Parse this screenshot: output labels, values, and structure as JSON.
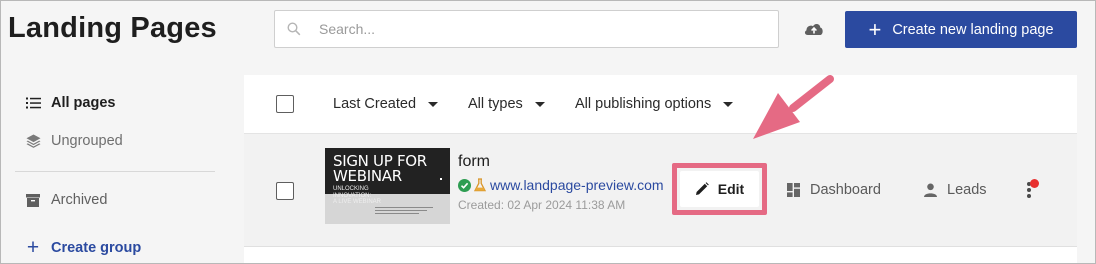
{
  "header": {
    "title": "Landing Pages",
    "search_placeholder": "Search...",
    "upload_icon": "cloud-upload-icon",
    "create_label": "Create new landing page",
    "accent": "#2b4aa0"
  },
  "sidebar": {
    "items": [
      {
        "label": "All pages",
        "icon": "list-icon",
        "active": true
      },
      {
        "label": "Ungrouped",
        "icon": "layers-icon"
      },
      {
        "label": "Archived",
        "icon": "archive-icon"
      },
      {
        "label": "Create group",
        "icon": "plus-icon"
      }
    ]
  },
  "filters": {
    "sort": "Last Created",
    "types": "All types",
    "publishing": "All publishing options"
  },
  "row": {
    "thumbnail": {
      "headline_1": "SIGN UP FOR",
      "headline_2": "WEBINAR",
      "sub_1": "UNLOCKING",
      "sub_2": "INNOVATION:",
      "sub_3": "A LIVE WEBINAR"
    },
    "name": "form",
    "status_icon": "check-circle-icon",
    "test_icon": "flask-icon",
    "url": "www.landpage-preview.com",
    "created": "Created: 02 Apr 2024 11:38 AM",
    "actions": {
      "edit": "Edit",
      "dashboard": "Dashboard",
      "leads": "Leads"
    },
    "notification_color": "#e8302f"
  },
  "annotation": {
    "highlight_color": "#e56a84"
  }
}
